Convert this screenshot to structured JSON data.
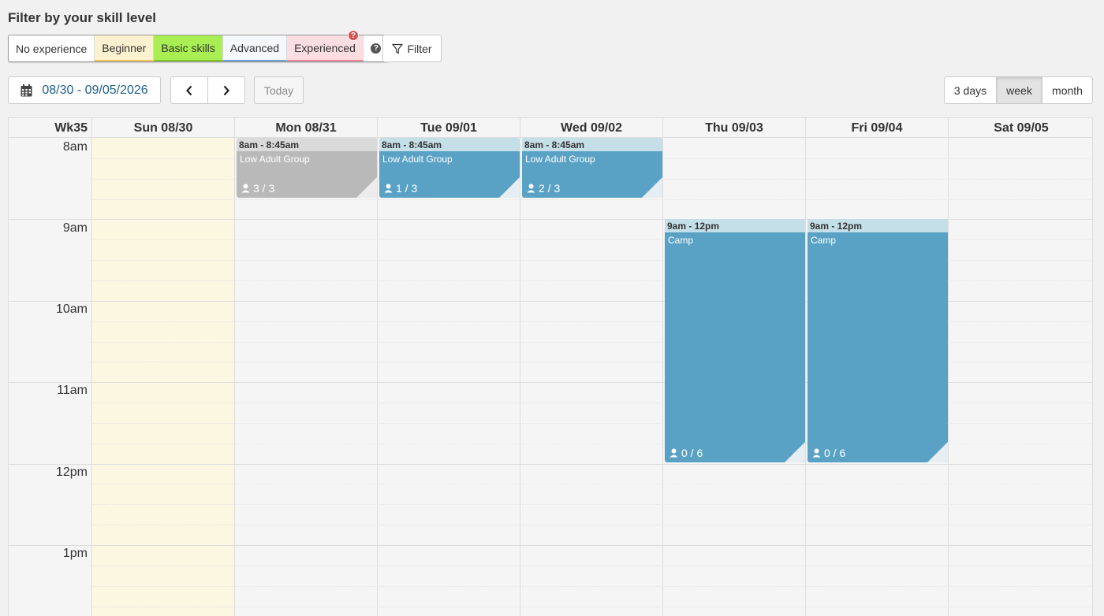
{
  "filter": {
    "heading": "Filter by your skill level",
    "levels": [
      {
        "label": "No experience",
        "color": "#ffffff"
      },
      {
        "label": "Beginner",
        "color": "#fdf2cf"
      },
      {
        "label": "Basic skills",
        "color": "#a9ee52"
      },
      {
        "label": "Advanced",
        "color": "#f4f7fb"
      },
      {
        "label": "Experienced",
        "color": "#fbdde2"
      }
    ],
    "help_icon": "?",
    "alert_icon": "?",
    "filter_button": "Filter"
  },
  "toolbar": {
    "date_range": "08/30 - 09/05/2026",
    "today": "Today",
    "views": [
      "3 days",
      "week",
      "month"
    ],
    "active_view": "week"
  },
  "calendar": {
    "week_label": "Wk35",
    "days": [
      "Sun 08/30",
      "Mon 08/31",
      "Tue 09/01",
      "Wed 09/02",
      "Thu 09/03",
      "Fri 09/04",
      "Sat 09/05"
    ],
    "today_column": "Sun 08/30",
    "hours": [
      "8am",
      "9am",
      "10am",
      "11am",
      "12pm",
      "1pm"
    ],
    "events": [
      {
        "day": "Mon 08/31",
        "time": "8am - 8:45am",
        "title": "Low Adult Group",
        "count": "3 / 3",
        "status": "full"
      },
      {
        "day": "Tue 09/01",
        "time": "8am - 8:45am",
        "title": "Low Adult Group",
        "count": "1 / 3",
        "status": "open"
      },
      {
        "day": "Wed 09/02",
        "time": "8am - 8:45am",
        "title": "Low Adult Group",
        "count": "2 / 3",
        "status": "open"
      },
      {
        "day": "Thu 09/03",
        "time": "9am - 12pm",
        "title": "Camp",
        "count": "0 / 6",
        "status": "open"
      },
      {
        "day": "Fri 09/04",
        "time": "9am - 12pm",
        "title": "Camp",
        "count": "0 / 6",
        "status": "open"
      }
    ],
    "colors": {
      "open": "#5aa2c5",
      "full": "#b9b9b9",
      "today_bg": "#fcf7e0"
    }
  }
}
